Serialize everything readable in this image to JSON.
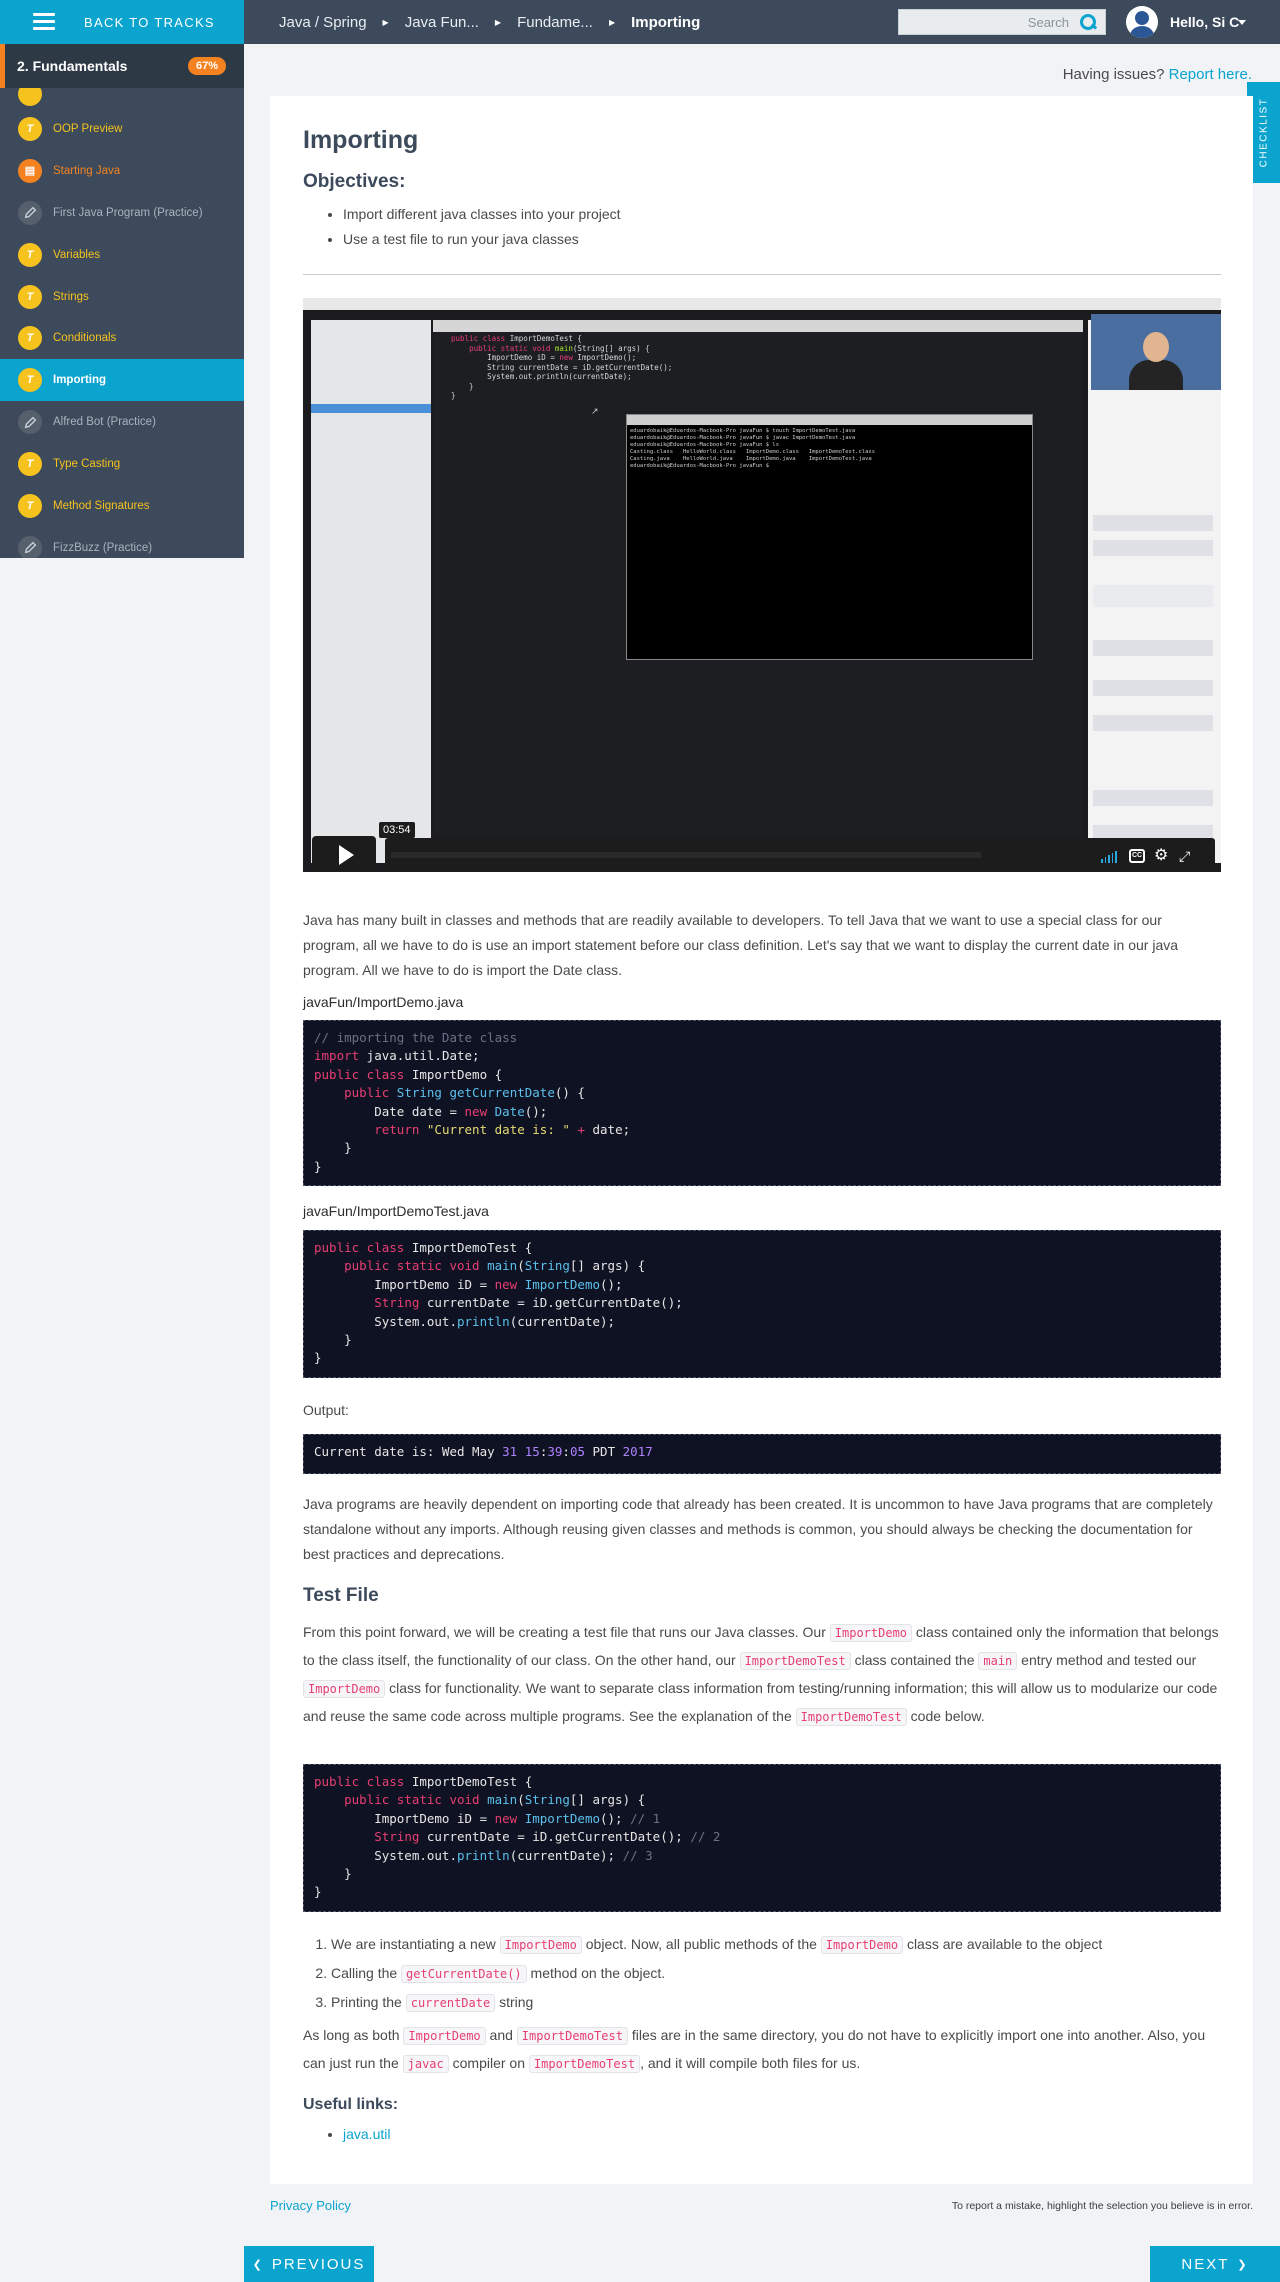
{
  "topbar": {
    "back_label": "BACK TO TRACKS",
    "breadcrumbs": [
      "Java / Spring",
      "Java Fun...",
      "Fundame...",
      "Importing"
    ],
    "search_placeholder": "Search",
    "user_greeting": "Hello, Si C"
  },
  "sidebar": {
    "section_title": "2. Fundamentals",
    "progress_badge": "67%",
    "items": [
      {
        "label": "OOP Preview",
        "style": "yellow",
        "icon": "T"
      },
      {
        "label": "Starting Java",
        "style": "orange",
        "icon": "slides"
      },
      {
        "label": "First Java Program (Practice)",
        "style": "grey",
        "icon": "pencil"
      },
      {
        "label": "Variables",
        "style": "yellow",
        "icon": "T"
      },
      {
        "label": "Strings",
        "style": "yellow",
        "icon": "T"
      },
      {
        "label": "Conditionals",
        "style": "yellow",
        "icon": "T"
      },
      {
        "label": "Importing",
        "style": "active",
        "icon": "T"
      },
      {
        "label": "Alfred Bot (Practice)",
        "style": "grey",
        "icon": "pencil"
      },
      {
        "label": "Type Casting",
        "style": "yellow",
        "icon": "T"
      },
      {
        "label": "Method Signatures",
        "style": "yellow",
        "icon": "T"
      },
      {
        "label": "FizzBuzz (Practice)",
        "style": "grey",
        "icon": "pencil"
      }
    ]
  },
  "issues": {
    "text": "Having issues?",
    "link": "Report here."
  },
  "checklist_label": "CHECKLIST",
  "page": {
    "title": "Importing",
    "objectives_heading": "Objectives:",
    "objectives": [
      "Import different java classes into your project",
      "Use a test file to run your java classes"
    ],
    "video": {
      "time": "03:54"
    },
    "intro": "Java has many built in classes and methods that are readily available to developers. To tell Java that we want to use a special class for our program, all we have to do is use an import statement before our class definition. Let's say that we want to display the current date in our java program. All we have to do is import the Date class.",
    "file1_label": "javaFun/ImportDemo.java",
    "file2_label": "javaFun/ImportDemoTest.java",
    "output_label": "Output:",
    "para2": "Java programs are heavily dependent on importing code that already has been created. It is uncommon to have Java programs that are completely standalone without any imports. Although reusing given classes and methods is common, you should always be checking the documentation for best practices and deprecations.",
    "test_heading": "Test File",
    "test_para": {
      "p1": "From this point forward, we will be creating a test file that runs our Java classes. Our",
      "c1": "ImportDemo",
      "p2": "class contained only the information that belongs to the class itself, the functionality of our class. On the other hand, our",
      "c2": "ImportDemoTest",
      "p3": "class contained the",
      "c3": "main",
      "p4": "entry method and tested our",
      "c4": "ImportDemo",
      "p5": "class for functionality. We want to separate class information from testing/running information; this will allow us to modularize our code and reuse the same code across multiple programs. See the explanation of the",
      "c5": "ImportDemoTest",
      "p6": "code below."
    },
    "steps": [
      {
        "a": "We are instantiating a new",
        "c1": "ImportDemo",
        "b": "object. Now, all public methods of the",
        "c2": "ImportDemo",
        "d": "class are available to the object"
      },
      {
        "a": "Calling the",
        "c1": "getCurrentDate()",
        "b": "method on the object."
      },
      {
        "a": "Printing the",
        "c1": "currentDate",
        "b": "string"
      }
    ],
    "closing": {
      "p1": "As long as both",
      "c1": "ImportDemo",
      "p2": "and",
      "c2": "ImportDemoTest",
      "p3": "files are in the same directory, you do not have to explicitly import one into another. Also, you can just run the",
      "c3": "javac",
      "p4": "compiler on",
      "c4": "ImportDemoTest",
      "p5": ", and it will compile both files for us."
    },
    "useful_heading": "Useful links:",
    "links": [
      "java.util"
    ]
  },
  "footer": {
    "privacy": "Privacy Policy",
    "report_note": "To report a mistake, highlight the selection you believe is in error.",
    "prev": "PREVIOUS",
    "next": "NEXT"
  },
  "colors": {
    "accent": "#0aa4cf",
    "sidebar_bg": "#3c4a5b",
    "badge": "#f58220",
    "yellow": "#f6c21d",
    "code_bg": "#0f1222"
  }
}
